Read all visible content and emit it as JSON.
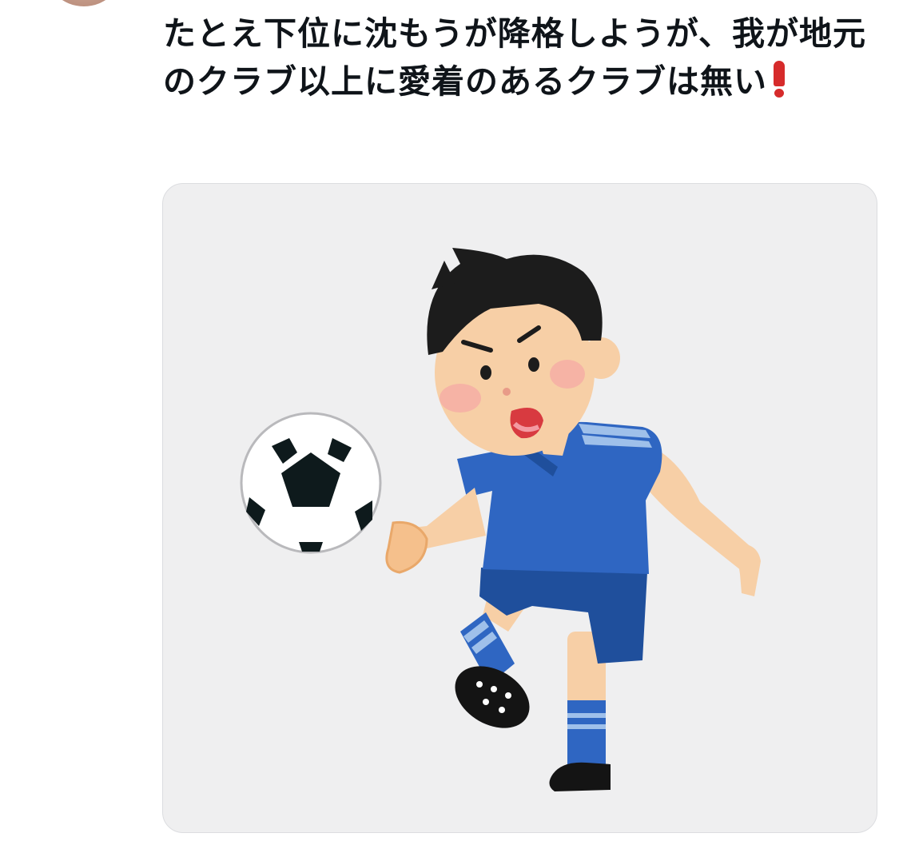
{
  "tweet": {
    "text": "たとえ下位に沈もうが降格しようが、我が地元のクラブ以上に愛着のあるクラブは無い",
    "emoji": "exclamation-mark-emoji"
  },
  "media": {
    "icons": [
      "soccer-player-illustration",
      "soccer-ball-icon"
    ],
    "colors": {
      "background": "#efeff0",
      "shirt": "#2f66c2",
      "shorts": "#1f4f9c",
      "skin": "#f7cfa6",
      "hair": "#1c1c1c",
      "exclamation": "#d62b2b"
    }
  }
}
